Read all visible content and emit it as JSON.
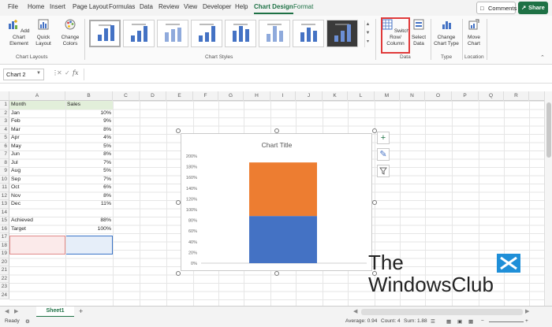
{
  "ribbon": {
    "tabs": [
      "File",
      "Home",
      "Insert",
      "Page Layout",
      "Formulas",
      "Data",
      "Review",
      "View",
      "Developer",
      "Help",
      "Chart Design",
      "Format"
    ],
    "active_tab": "Chart Design",
    "comments_label": "Comments",
    "share_label": "Share",
    "buttons": {
      "add_chart_element": "Add Chart Element",
      "quick_layout": "Quick Layout",
      "change_colors": "Change Colors",
      "switch_row_column": "Switch Row/ Column",
      "select_data": "Select Data",
      "change_chart_type": "Change Chart Type",
      "move_chart": "Move Chart"
    },
    "groups": {
      "chart_layouts": "Chart Layouts",
      "chart_styles": "Chart Styles",
      "data": "Data",
      "type": "Type",
      "location": "Location"
    }
  },
  "formula_bar": {
    "name_box": "Chart 2",
    "fx": "fx",
    "value": ""
  },
  "grid": {
    "columns": [
      "A",
      "B",
      "C",
      "D",
      "E",
      "F",
      "G",
      "H",
      "I",
      "J",
      "K",
      "L",
      "M",
      "N",
      "O",
      "P",
      "Q",
      "R",
      "S"
    ],
    "rows": [
      1,
      2,
      3,
      4,
      5,
      6,
      7,
      8,
      9,
      10,
      11,
      12,
      13,
      14,
      15,
      16,
      17,
      18,
      19,
      20,
      21,
      22,
      23,
      24
    ],
    "header": {
      "month": "Month",
      "sales": "Sales"
    },
    "data": [
      {
        "month": "Jan",
        "sales": "10%"
      },
      {
        "month": "Feb",
        "sales": "9%"
      },
      {
        "month": "Mar",
        "sales": "8%"
      },
      {
        "month": "Apr",
        "sales": "4%"
      },
      {
        "month": "May",
        "sales": "5%"
      },
      {
        "month": "Jun",
        "sales": "8%"
      },
      {
        "month": "Jul",
        "sales": "7%"
      },
      {
        "month": "Aug",
        "sales": "5%"
      },
      {
        "month": "Sep",
        "sales": "7%"
      },
      {
        "month": "Oct",
        "sales": "6%"
      },
      {
        "month": "Nov",
        "sales": "8%"
      },
      {
        "month": "Dec",
        "sales": "11%"
      }
    ],
    "summary": [
      {
        "label": "Achieved",
        "value": "88%"
      },
      {
        "label": "Target",
        "value": "100%"
      }
    ]
  },
  "chart_data": {
    "type": "bar",
    "stacked": true,
    "title": "Chart Title",
    "categories": [
      ""
    ],
    "series": [
      {
        "values": [
          88
        ],
        "color": "#4472c4"
      },
      {
        "values": [
          100
        ],
        "color": "#ed7d31"
      }
    ],
    "yticks": [
      "0%",
      "20%",
      "40%",
      "60%",
      "80%",
      "100%",
      "120%",
      "140%",
      "160%",
      "180%",
      "200%"
    ],
    "ylim": [
      0,
      200
    ],
    "grid": false
  },
  "sheet": {
    "tab_name": "Sheet1",
    "add_label": "+"
  },
  "status": {
    "ready": "Ready",
    "average": "Average: 0.94",
    "count": "Count: 4",
    "sum": "Sum: 1.88"
  },
  "watermark": {
    "line1": "The",
    "line2": "WindowsClub"
  }
}
